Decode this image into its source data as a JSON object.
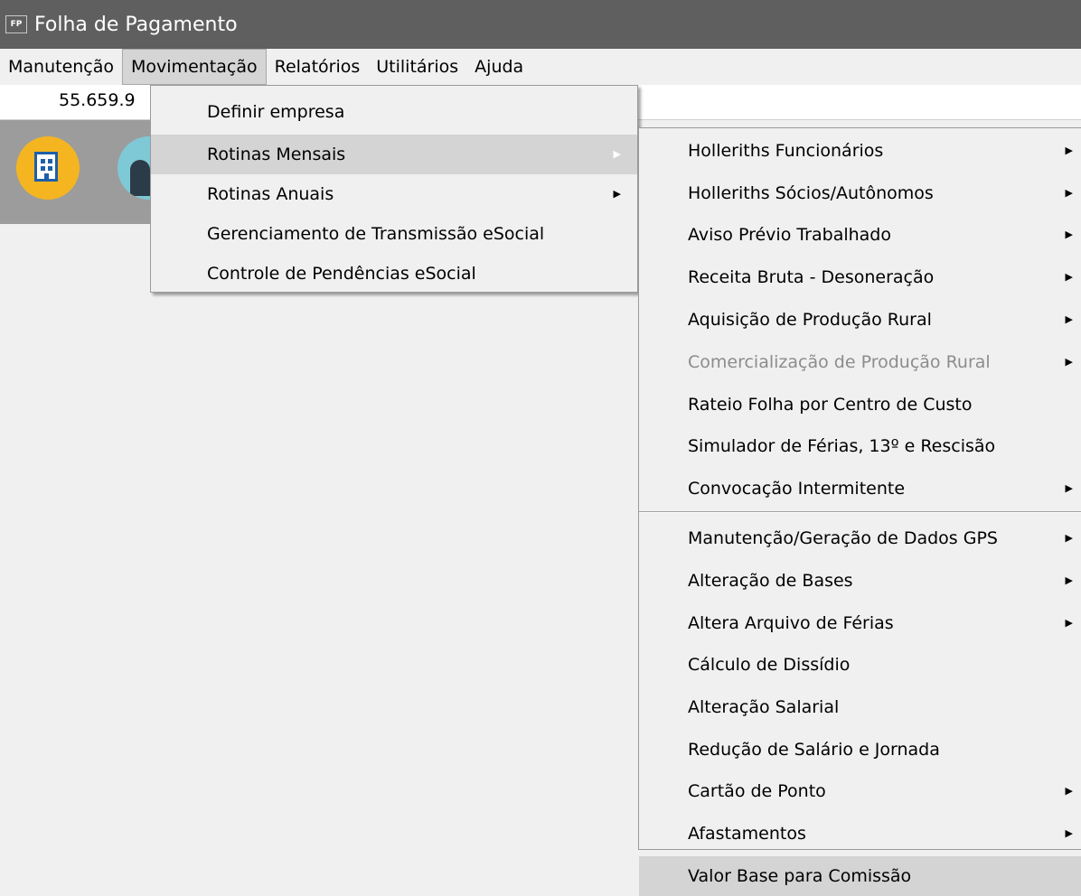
{
  "window": {
    "icon_text": "FP",
    "title": "Folha de Pagamento"
  },
  "menubar": {
    "items": [
      {
        "label": "Manutenção"
      },
      {
        "label": "Movimentação"
      },
      {
        "label": "Relatórios"
      },
      {
        "label": "Utilitários"
      },
      {
        "label": "Ajuda"
      }
    ]
  },
  "infobar": {
    "cnpj": "55.659.9"
  },
  "toolbar": {
    "icons": [
      "building-icon",
      "user-icon"
    ]
  },
  "dropdown": {
    "items": [
      {
        "label": "Definir empresa"
      },
      {
        "label": "Rotinas Mensais",
        "has_submenu": true,
        "highlighted": true
      },
      {
        "label": "Rotinas Anuais",
        "has_submenu": true
      },
      {
        "label": "Gerenciamento de Transmissão eSocial"
      },
      {
        "label": "Controle de Pendências eSocial"
      }
    ]
  },
  "submenu": {
    "items": [
      {
        "label": "Holleriths Funcionários",
        "has_submenu": true
      },
      {
        "label": "Holleriths Sócios/Autônomos",
        "has_submenu": true
      },
      {
        "label": "Aviso Prévio Trabalhado",
        "has_submenu": true
      },
      {
        "label": "Receita Bruta - Desoneração",
        "has_submenu": true
      },
      {
        "label": "Aquisição de Produção Rural",
        "has_submenu": true
      },
      {
        "label": "Comercialização de Produção Rural",
        "has_submenu": true,
        "disabled": true
      },
      {
        "label": "Rateio Folha por Centro de Custo"
      },
      {
        "label": "Simulador de Férias, 13º e Rescisão"
      },
      {
        "label": "Convocação Intermitente",
        "has_submenu": true
      },
      {
        "label": "Manutenção/Geração de Dados GPS",
        "has_submenu": true
      },
      {
        "label": "Alteração de Bases",
        "has_submenu": true
      },
      {
        "label": "Altera Arquivo de Férias",
        "has_submenu": true
      },
      {
        "label": "Cálculo de Dissídio"
      },
      {
        "label": "Alteração Salarial"
      },
      {
        "label": "Redução de Salário e Jornada"
      },
      {
        "label": "Cartão de Ponto",
        "has_submenu": true
      },
      {
        "label": "Afastamentos",
        "has_submenu": true
      },
      {
        "label": "Valor Base para Comissão",
        "highlighted": true
      }
    ]
  }
}
